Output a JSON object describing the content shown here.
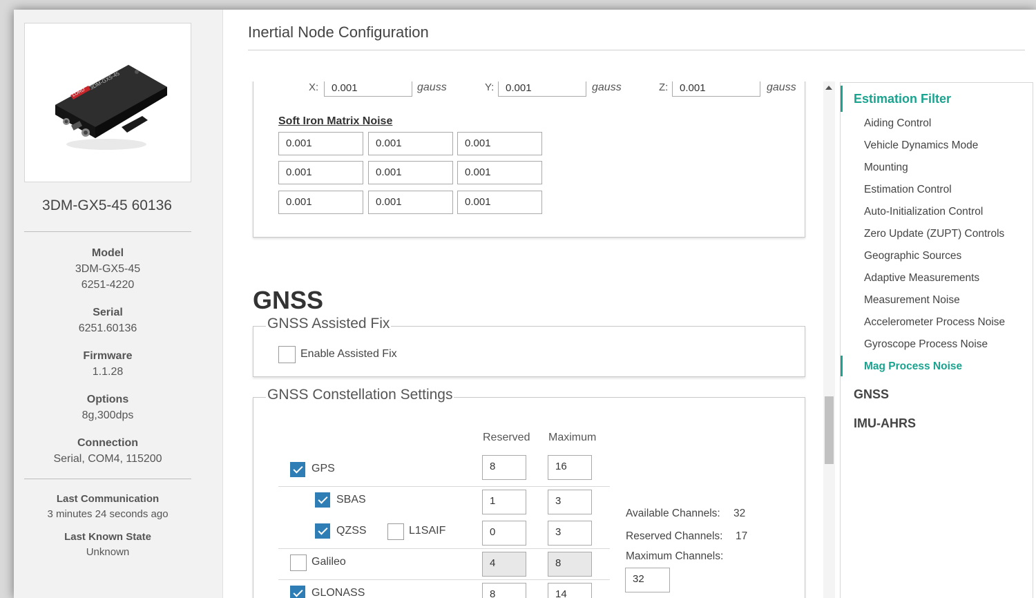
{
  "device": {
    "name": "3DM-GX5-45 60136",
    "model_label": "Model",
    "model_name": "3DM-GX5-45",
    "model_number": "6251-4220",
    "serial_label": "Serial",
    "serial": "6251.60136",
    "firmware_label": "Firmware",
    "firmware": "1.1.28",
    "options_label": "Options",
    "options": "8g,300dps",
    "connection_label": "Connection",
    "connection": "Serial, COM4, 115200",
    "last_comm_label": "Last Communication",
    "last_comm": "3 minutes 24 seconds ago",
    "last_state_label": "Last Known State",
    "last_state": "Unknown",
    "image_brand_text": "LORD",
    "image_model_text": "3DM-GX5-45"
  },
  "page": {
    "title": "Inertial Node Configuration"
  },
  "hard_iron": {
    "x_label": "X:",
    "x_value": "0.001",
    "y_label": "Y:",
    "y_value": "0.001",
    "z_label": "Z:",
    "z_value": "0.001",
    "unit": "gauss"
  },
  "soft_iron": {
    "title": "Soft Iron Matrix Noise",
    "matrix": [
      [
        "0.001",
        "0.001",
        "0.001"
      ],
      [
        "0.001",
        "0.001",
        "0.001"
      ],
      [
        "0.001",
        "0.001",
        "0.001"
      ]
    ]
  },
  "gnss": {
    "heading": "GNSS",
    "assisted_fix": {
      "legend": "GNSS Assisted Fix",
      "enable_label": "Enable Assisted Fix",
      "enabled": false
    },
    "constellation": {
      "legend": "GNSS Constellation Settings",
      "col_reserved": "Reserved",
      "col_maximum": "Maximum",
      "rows": [
        {
          "label": "GPS",
          "checked": true,
          "reserved": "8",
          "maximum": "16"
        },
        {
          "label": "SBAS",
          "checked": true,
          "reserved": "1",
          "maximum": "3"
        },
        {
          "label": "QZSS",
          "checked": true,
          "extra_label": "L1SAIF",
          "extra_checked": false,
          "reserved": "0",
          "maximum": "3"
        },
        {
          "label": "Galileo",
          "checked": false,
          "reserved": "4",
          "maximum": "8"
        },
        {
          "label": "GLONASS",
          "checked": true,
          "reserved": "8",
          "maximum": "14"
        }
      ],
      "available_label": "Available Channels:",
      "available_value": "32",
      "reserved_label": "Reserved Channels:",
      "reserved_value": "17",
      "maximum_label": "Maximum Channels:",
      "maximum_value": "32"
    }
  },
  "nav": {
    "sections": [
      {
        "label": "Estimation Filter",
        "active": true,
        "items": [
          "Aiding Control",
          "Vehicle Dynamics Mode",
          "Mounting",
          "Estimation Control",
          "Auto-Initialization Control",
          "Zero Update (ZUPT) Controls",
          "Geographic Sources",
          "Adaptive Measurements",
          "Measurement Noise",
          "Accelerometer Process Noise",
          "Gyroscope Process Noise",
          "Mag Process Noise"
        ],
        "active_item": "Mag Process Noise"
      },
      {
        "label": "GNSS",
        "active": false
      },
      {
        "label": "IMU-AHRS",
        "active": false
      }
    ]
  },
  "colors": {
    "accent": "#1aa38f",
    "checkbox": "#2f7db5"
  }
}
